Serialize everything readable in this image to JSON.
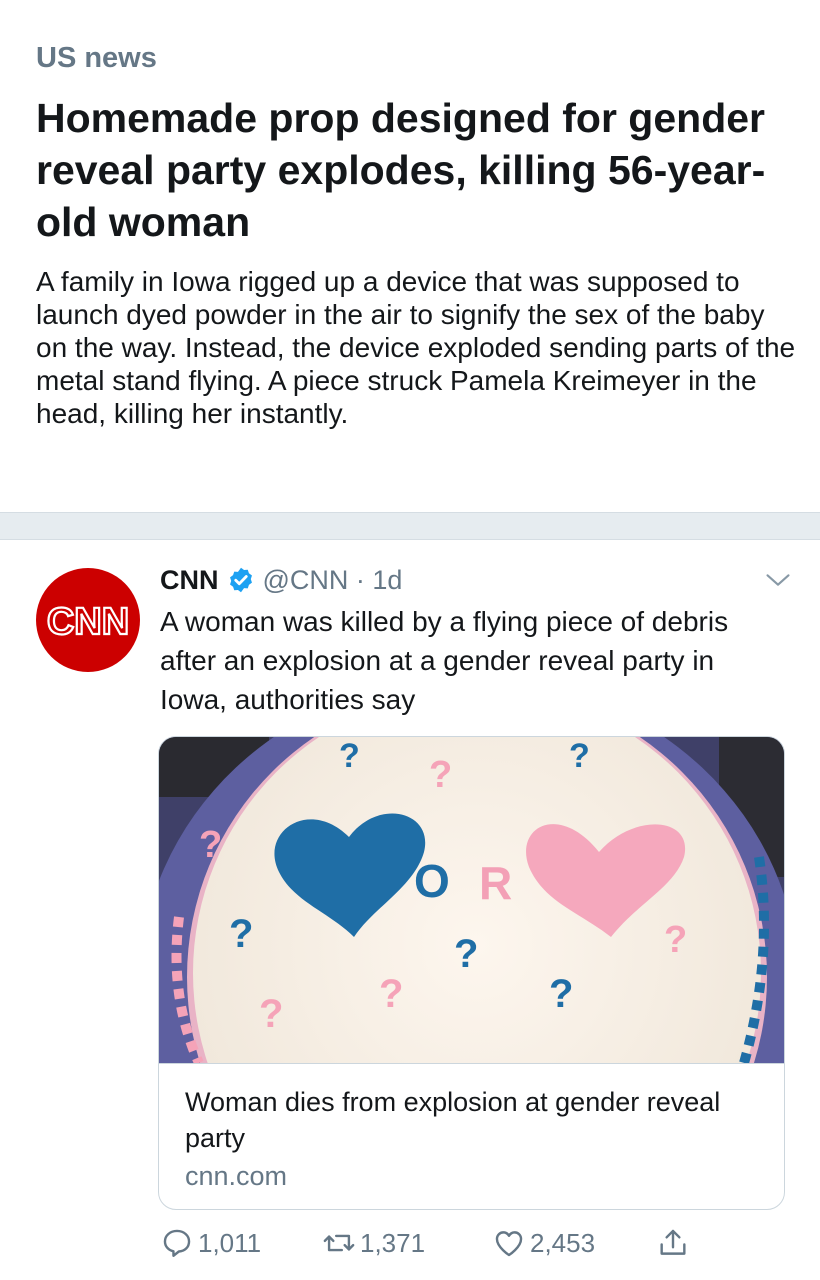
{
  "news": {
    "section": "US news",
    "headline": "Homemade prop designed for gender reveal party explodes, killing 56-year-old woman",
    "summary": "A family in Iowa rigged up a device that was supposed to launch dyed powder in the air to signify the sex of the baby on the way. Instead, the device exploded sending parts of the metal stand flying. A piece struck Pamela Kreimeyer in the head, killing her instantly."
  },
  "tweet": {
    "avatar_text": "CNN",
    "name": "CNN",
    "meta": "@CNN · 1d",
    "text": "A woman was killed by a flying piece of debris after an explosion at a gender reveal party in Iowa, authorities say",
    "card": {
      "image_text": "OR",
      "title": "Woman dies from explosion at gender reveal party",
      "domain": "cnn.com"
    },
    "actions": {
      "replies": "1,011",
      "retweets": "1,371",
      "likes": "2,453"
    }
  },
  "icons": {
    "verified": "verified-badge-icon",
    "caret": "chevron-down-icon",
    "reply": "reply-bubble-icon",
    "retweet": "retweet-icon",
    "like": "heart-icon",
    "share": "share-icon"
  },
  "colors": {
    "cnn_red": "#cc0000",
    "verified_blue": "#1da1f2",
    "muted": "#657786",
    "cake_blue": "#1f6ea6",
    "cake_pink": "#f5a3b8"
  }
}
